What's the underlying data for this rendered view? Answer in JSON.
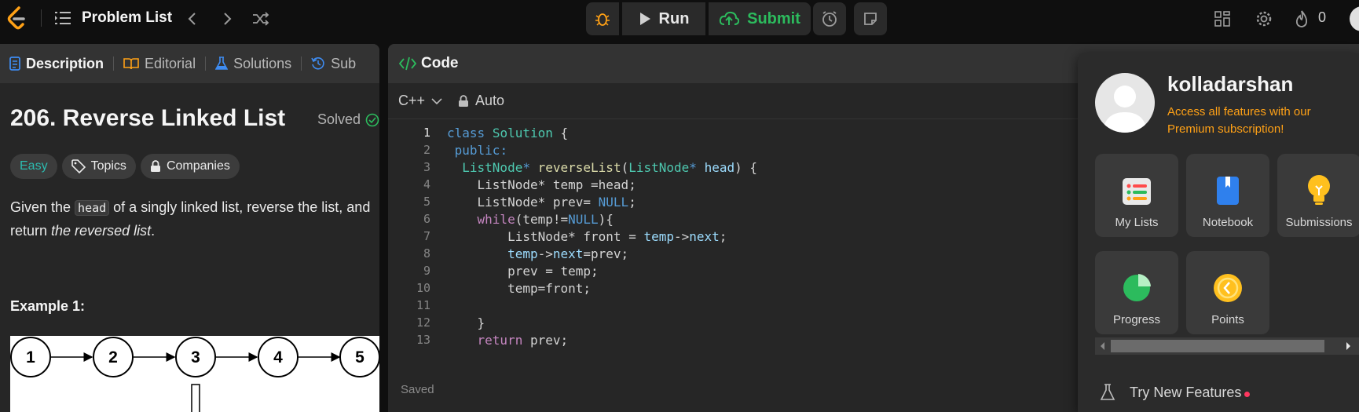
{
  "topbar": {
    "problem_list_label": "Problem List",
    "run_label": "Run",
    "submit_label": "Submit",
    "streak_count": "0"
  },
  "left_panel": {
    "tabs": [
      {
        "label": "Description",
        "icon": "description-icon"
      },
      {
        "label": "Editorial",
        "icon": "book-icon"
      },
      {
        "label": "Solutions",
        "icon": "flask-icon"
      },
      {
        "label": "Sub",
        "icon": "history-icon"
      }
    ],
    "problem_title": "206. Reverse Linked List",
    "solved_label": "Solved",
    "chips": [
      "Easy",
      "Topics",
      "Companies"
    ],
    "description_before": "Given the ",
    "description_code": "head",
    "description_after": " of a singly linked list, reverse the list, and return ",
    "description_em": "the reversed list",
    "description_end": ".",
    "example_title": "Example 1:",
    "example_nodes": [
      "1",
      "2",
      "3",
      "4",
      "5"
    ]
  },
  "code_panel": {
    "title": "Code",
    "language": "C++",
    "mode": "Auto",
    "status": "Saved",
    "line_numbers": [
      "1",
      "2",
      "3",
      "4",
      "5",
      "6",
      "7",
      "8",
      "9",
      "10",
      "11",
      "12",
      "13"
    ]
  },
  "user_menu": {
    "username": "kolladarshan",
    "premium_text": "Access all features with our Premium subscription!",
    "tiles": [
      "My Lists",
      "Notebook",
      "Submissions",
      "Progress",
      "Points"
    ],
    "try_new_label": "Try New Features",
    "colors": {
      "premium": "#ffa116",
      "new_dot": "#ff375f"
    }
  }
}
